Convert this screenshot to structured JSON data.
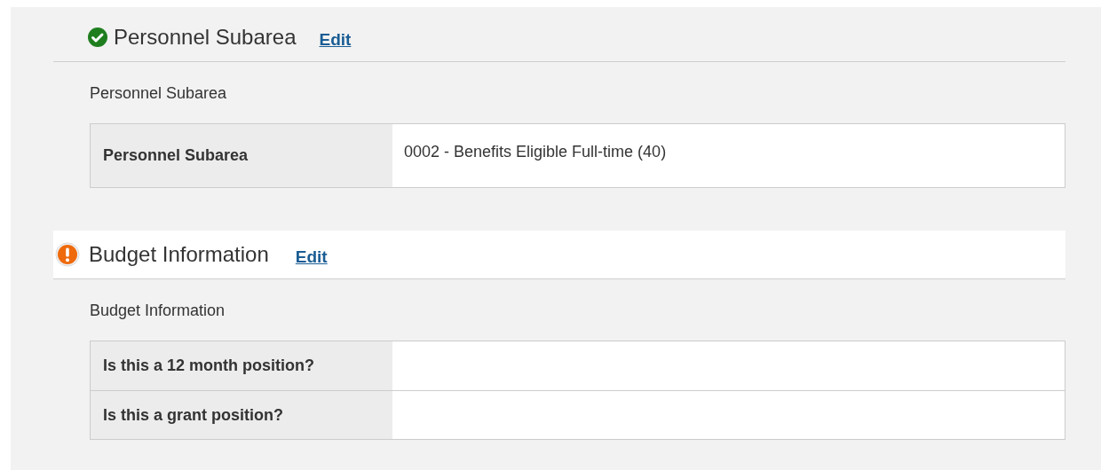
{
  "sections": [
    {
      "title": "Personnel Subarea",
      "kind": "complete",
      "highlighted": false,
      "edit_link": "Edit",
      "subtitle": "Personnel Subarea",
      "rows": [
        {
          "label": "Personnel Subarea",
          "value": "0002 - Benefits Eligible Full-time (40)"
        }
      ]
    },
    {
      "title": "Budget Information",
      "kind": "warning",
      "highlighted": true,
      "edit_link": "Edit",
      "subtitle": "Budget Information",
      "rows": [
        {
          "label": "Is this a 12 month position?"
        },
        {
          "label": "Is this a grant position?"
        }
      ]
    }
  ]
}
